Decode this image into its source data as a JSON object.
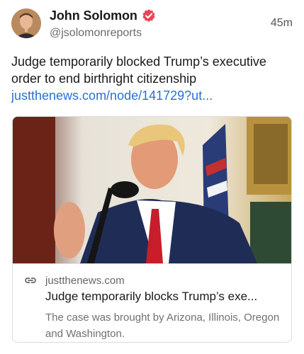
{
  "author": {
    "name": "John Solomon",
    "handle": "@jsolomonreports",
    "time": "45m"
  },
  "post": {
    "text": "Judge temporarily blocked Trump’s executive order to end birthright citizenship",
    "link": "justthenews.com/node/141729?ut..."
  },
  "card": {
    "domain": "justthenews.com",
    "title": "Judge temporarily blocks Trump’s exe...",
    "description": "The case was brought by Arizona, Illinois, Oregon and Washington."
  },
  "colors": {
    "link": "#2a6fd6",
    "verified": "#e8455a"
  }
}
